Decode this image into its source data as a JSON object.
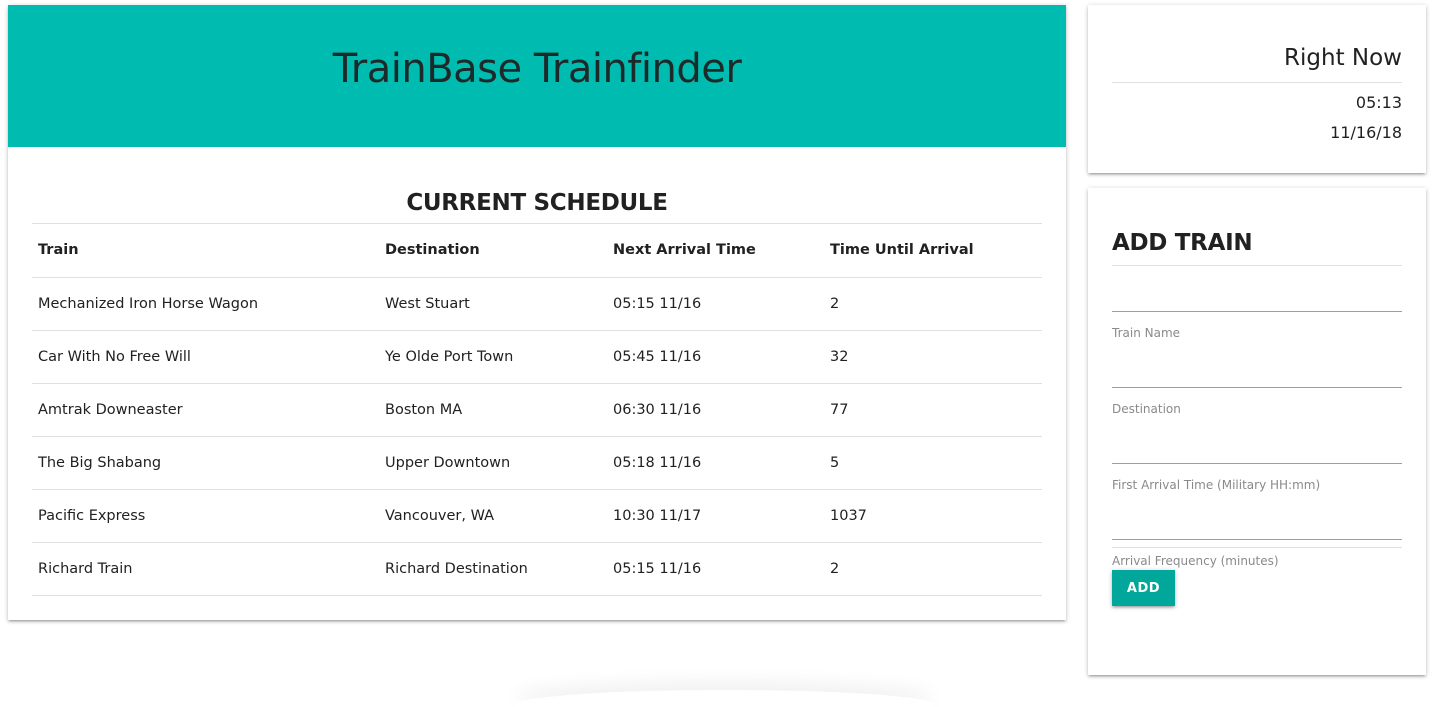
{
  "header": {
    "title": "TrainBase Trainfinder"
  },
  "schedule": {
    "title": "CURRENT SCHEDULE",
    "columns": [
      "Train",
      "Destination",
      "Next Arrival Time",
      "Time Until Arrival"
    ],
    "rows": [
      [
        "Mechanized Iron Horse Wagon",
        "West Stuart",
        "05:15 11/16",
        "2"
      ],
      [
        "Car With No Free Will",
        "Ye Olde Port Town",
        "05:45 11/16",
        "32"
      ],
      [
        "Amtrak Downeaster",
        "Boston MA",
        "06:30 11/16",
        "77"
      ],
      [
        "The Big Shabang",
        "Upper Downtown",
        "05:18 11/16",
        "5"
      ],
      [
        "Pacific Express",
        "Vancouver, WA",
        "10:30 11/17",
        "1037"
      ],
      [
        "Richard Train",
        "Richard Destination",
        "05:15 11/16",
        "2"
      ]
    ]
  },
  "right_now": {
    "title": "Right Now",
    "time": "05:13",
    "date": "11/16/18"
  },
  "add_train": {
    "title": "ADD TRAIN",
    "fields": [
      {
        "label": "Train Name",
        "value": ""
      },
      {
        "label": "Destination",
        "value": ""
      },
      {
        "label": "First Arrival Time (Military HH:mm)",
        "value": ""
      },
      {
        "label": "Arrival Frequency (minutes)",
        "value": ""
      }
    ],
    "button_label": "ADD"
  },
  "colors": {
    "banner": "#00bbb0",
    "button": "#00a79a"
  }
}
